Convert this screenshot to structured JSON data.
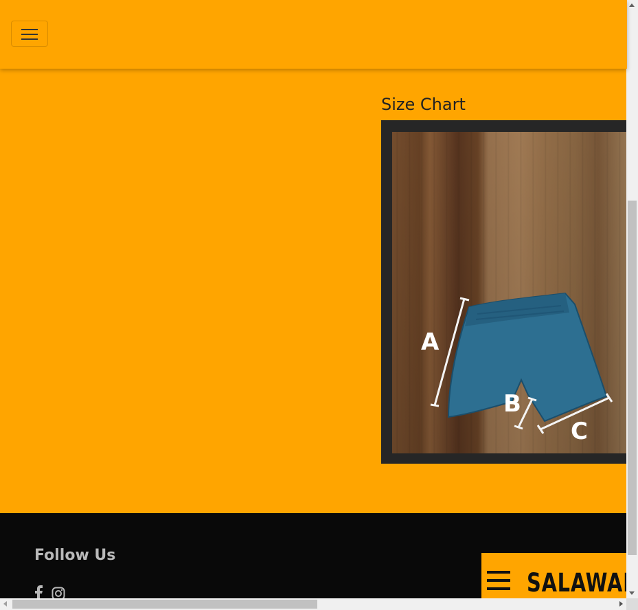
{
  "navbar": {
    "toggler_icon": "hamburger-menu-icon"
  },
  "main": {
    "size_chart_title": "Size Chart",
    "size_chart_labels": {
      "a": "A",
      "b": "B",
      "c": "C"
    }
  },
  "footer": {
    "follow_title": "Follow Us",
    "social_icons": [
      "facebook-icon",
      "instagram-icon"
    ],
    "logo_text": "SALAWAL"
  },
  "colors": {
    "brand": "#ffa500",
    "footer_bg": "#090909",
    "shorts": "#2d6f91"
  }
}
